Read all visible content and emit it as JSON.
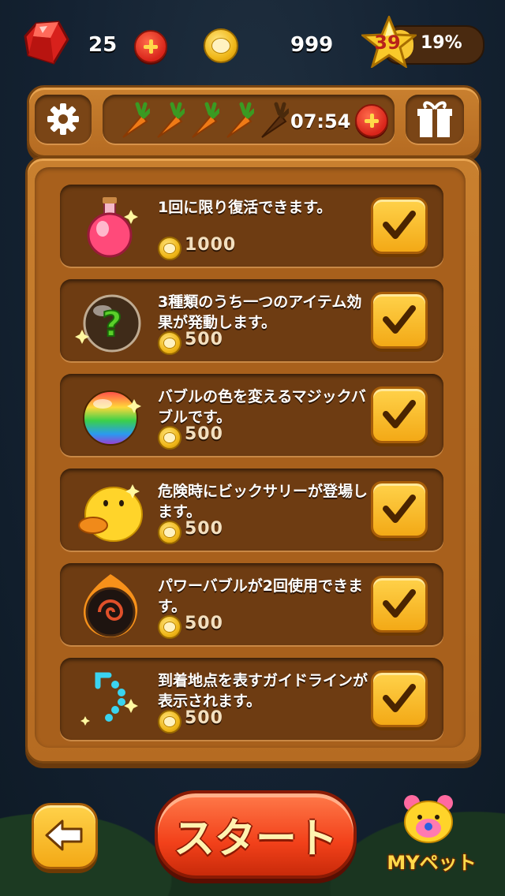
{
  "header": {
    "gems": "25",
    "coins": "999",
    "level": "39",
    "level_progress_percent": "19%",
    "level_progress": 0.19
  },
  "energy": {
    "carrots_full": 4,
    "carrots_total": 5,
    "timer": "07:54"
  },
  "items": [
    {
      "icon": "potion-icon",
      "description": "1回に限り復活できます。",
      "price": "1000",
      "checked": true
    },
    {
      "icon": "mystery-bubble-icon",
      "description": "3種類のうち一つのアイテム効果が発動します。",
      "price": "500",
      "checked": true
    },
    {
      "icon": "rainbow-bubble-icon",
      "description": "バブルの色を変えるマジックバブルです。",
      "price": "500",
      "checked": true
    },
    {
      "icon": "sally-chick-icon",
      "description": "危険時にビックサリーが登場します。",
      "price": "500",
      "checked": true
    },
    {
      "icon": "power-bubble-icon",
      "description": "パワーバブルが2回使用できます。",
      "price": "500",
      "checked": true
    },
    {
      "icon": "guide-line-icon",
      "description": "到着地点を表すガイドラインが表示されます。",
      "price": "500",
      "checked": true
    }
  ],
  "footer": {
    "start_label": "スタート",
    "pet_label": "MYペット"
  },
  "colors": {
    "wood": "#b56b22",
    "check_button": "#f3a916",
    "start_button": "#f2411a"
  }
}
